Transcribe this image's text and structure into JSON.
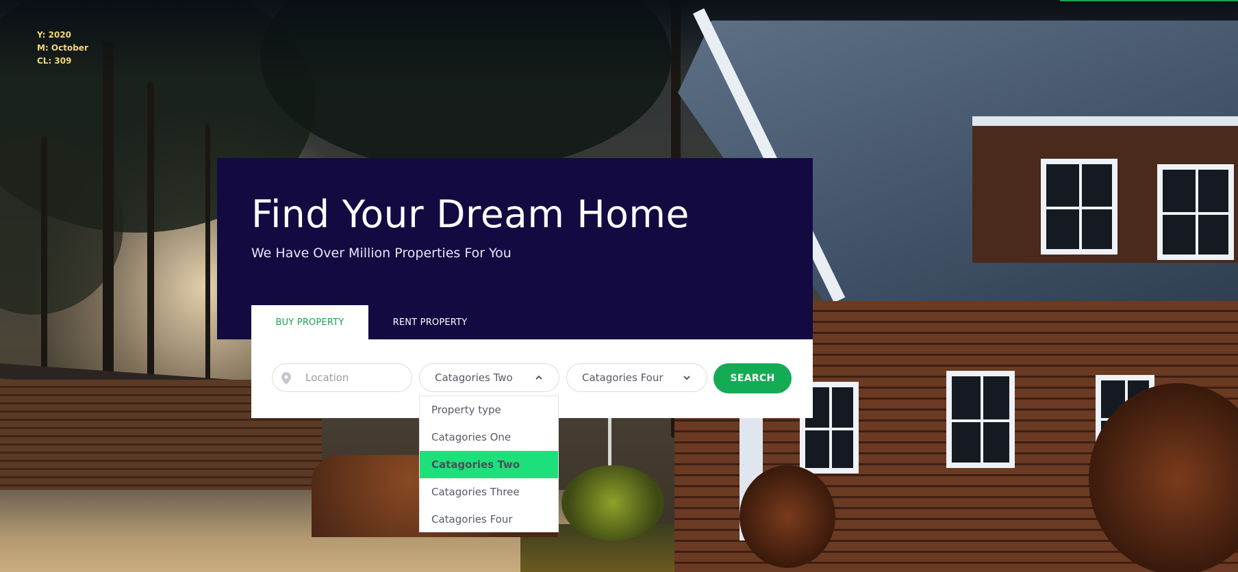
{
  "overlay": {
    "year": "Y: 2020",
    "month": "M: October",
    "cl": "CL: 309"
  },
  "hero": {
    "title": "Find Your Dream Home",
    "subtitle": "We Have Over Million Properties For You"
  },
  "tabs": [
    {
      "label": "BUY PROPERTY",
      "active": true
    },
    {
      "label": "RENT PROPERTY",
      "active": false
    }
  ],
  "search": {
    "location_placeholder": "Location",
    "location_icon": "map-pin-icon",
    "select_one_value": "Catagories Two",
    "select_two_value": "Catagories Four",
    "button_label": "SEARCH"
  },
  "dropdown": {
    "options": [
      "Property type",
      "Catagories One",
      "Catagories Two",
      "Catagories Three",
      "Catagories Four"
    ],
    "selected_index": 2
  },
  "colors": {
    "hero_bg": "#140a42",
    "accent_green": "#14ab55",
    "highlight_green": "#1ee07a"
  }
}
